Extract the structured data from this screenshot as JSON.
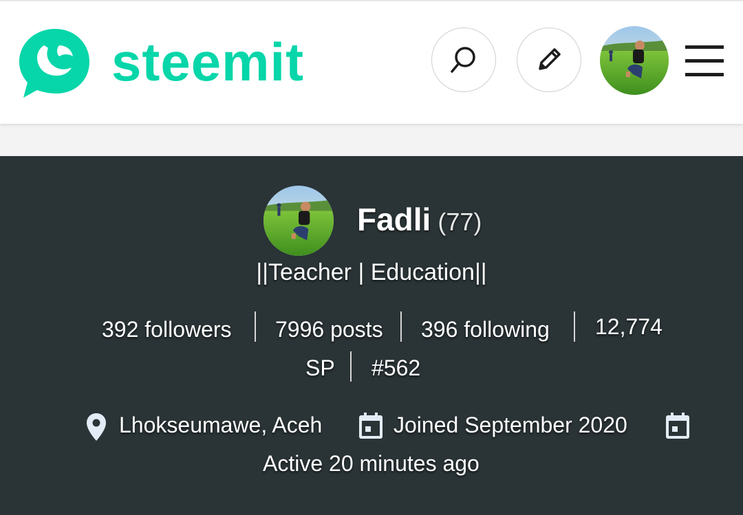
{
  "header": {
    "logo_text": "steemit",
    "brand_color": "#06d6a9",
    "search_icon": "search-icon",
    "write_icon": "pencil-icon",
    "menu_icon": "hamburger-menu-icon"
  },
  "profile": {
    "name": "Fadli",
    "reputation": "(77)",
    "about": "||Teacher | Education||",
    "stats": {
      "followers": "392 followers",
      "posts": "7996 posts",
      "following": "396 following",
      "sp_value": "12,774",
      "sp_unit": "SP",
      "rank": "#562"
    },
    "location": "Lhokseumawe, Aceh",
    "joined": "Joined September 2020",
    "active": "Active 20 minutes ago",
    "banner_color": "#2a3336"
  }
}
